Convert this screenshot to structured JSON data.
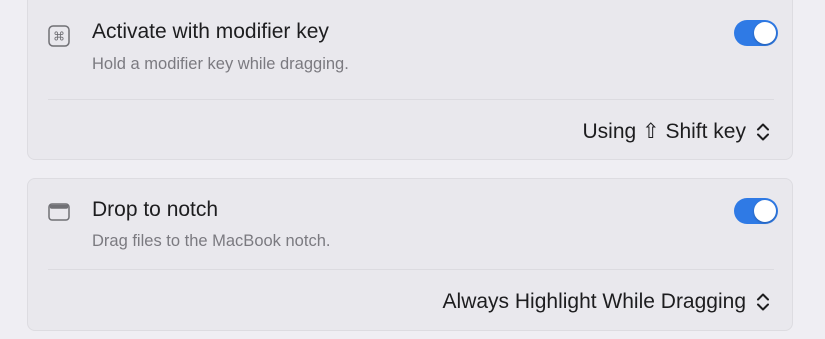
{
  "settings": [
    {
      "icon": "command-key-icon",
      "title": "Activate with modifier key",
      "subtitle": "Hold a modifier key while dragging.",
      "enabled": true,
      "select_value": "Using ⇧ Shift key"
    },
    {
      "icon": "notch-window-icon",
      "title": "Drop to notch",
      "subtitle": "Drag files to the MacBook notch.",
      "enabled": true,
      "select_value": "Always Highlight While Dragging"
    }
  ],
  "colors": {
    "toggle_on": "#2f7ae5",
    "background": "#efeef3",
    "card": "#e9e8ed",
    "secondary_text": "#7b7a80"
  }
}
